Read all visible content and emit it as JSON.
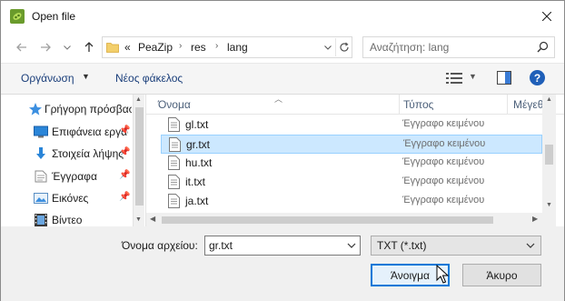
{
  "window": {
    "title": "Open file"
  },
  "address": {
    "overflow": "«",
    "crumbs": [
      "PeaZip",
      "res",
      "lang"
    ]
  },
  "search": {
    "placeholder": "Αναζήτηση: lang"
  },
  "toolbar": {
    "organize": "Οργάνωση",
    "new_folder": "Νέος φάκελος",
    "help": "?"
  },
  "sidebar": {
    "items": [
      {
        "label": "Γρήγορη πρόσβαση",
        "icon": "star-icon"
      },
      {
        "label": "Επιφάνεια εργασίας",
        "icon": "desktop-icon"
      },
      {
        "label": "Στοιχεία λήψης",
        "icon": "download-icon"
      },
      {
        "label": "Έγγραφα",
        "icon": "documents-icon"
      },
      {
        "label": "Εικόνες",
        "icon": "pictures-icon"
      },
      {
        "label": "Βίντεο",
        "icon": "videos-icon"
      }
    ]
  },
  "columns": {
    "name": "Όνομα",
    "type": "Τύπος",
    "size": "Μέγεθ"
  },
  "files": [
    {
      "name": "gl.txt",
      "type": "Έγγραφο κειμένου",
      "selected": false
    },
    {
      "name": "gr.txt",
      "type": "Έγγραφο κειμένου",
      "selected": true
    },
    {
      "name": "hu.txt",
      "type": "Έγγραφο κειμένου",
      "selected": false
    },
    {
      "name": "it.txt",
      "type": "Έγγραφο κειμένου",
      "selected": false
    },
    {
      "name": "ja.txt",
      "type": "Έγγραφο κειμένου",
      "selected": false
    }
  ],
  "filename": {
    "label": "Όνομα αρχείου:",
    "value": "gr.txt"
  },
  "filetype": {
    "value": "TXT (*.txt)"
  },
  "buttons": {
    "open": "Άνοιγμα",
    "cancel": "Άκυρο"
  },
  "colors": {
    "accent": "#0078d7",
    "selection": "#cce8ff",
    "link": "#1a3e7a"
  }
}
